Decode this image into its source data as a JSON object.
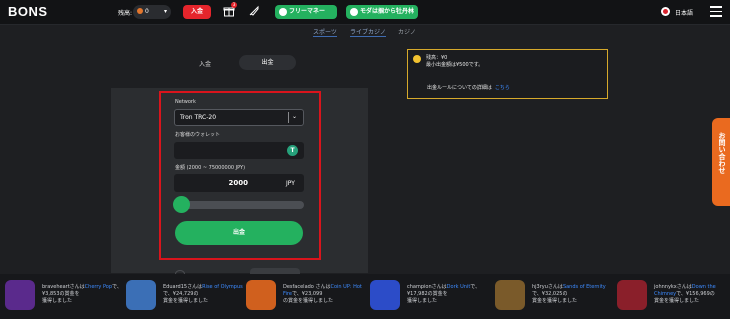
{
  "header": {
    "logo": "BONS",
    "balance_label": "残高:",
    "balance_value": "0",
    "deposit_button": "入金",
    "gift_badge": "3",
    "free_money_button": "フリーマネー",
    "cashout_button": "モダは掴から牡丹林",
    "language": "日本語"
  },
  "nav": {
    "tabs": [
      {
        "label": "スポーツ",
        "active": true
      },
      {
        "label": "ライブカジノ",
        "active": true
      },
      {
        "label": "カジノ",
        "active": false
      }
    ]
  },
  "toggle": {
    "deposit": "入金",
    "withdraw": "出金"
  },
  "notice": {
    "line1": "残高：¥0",
    "line2": "最小出金額は¥500です。",
    "rule_text": "出金ルールについての詳細は",
    "rule_link": "こちら"
  },
  "form": {
    "network_label": "Network",
    "network_value": "Tron TRC-20",
    "wallet_label": "お客様のウォレット",
    "wallet_value": "",
    "amount_label": "金額 (2000 ~ 75000000 JPY)",
    "amount_value": "2000",
    "amount_currency": "JPY",
    "slider_fraction": 0.0,
    "submit_button": "出金"
  },
  "side_tab": "お問い合わせ",
  "winners": [
    {
      "user": "braveheartさんは",
      "game": "Cherry Pop",
      "line2": "で、¥3,853の賞金を",
      "line3": "獲得しました",
      "thumb_color": "#5a2a8c"
    },
    {
      "user": "Eduard15さんは",
      "game": "Rise of Olympus",
      "line2": "で、¥24,729の",
      "line3": "賞金を獲得しました",
      "thumb_color": "#3b6fb6"
    },
    {
      "user": "Desfacelado さんは",
      "game": "Coin UP: Hot Fire",
      "line2": "で、¥23,099",
      "line3": "の賞金を獲得しました",
      "thumb_color": "#d0601e"
    },
    {
      "user": "championさんは",
      "game": "Dork Unit",
      "line2": "で、¥17,982の賞金を",
      "line3": "獲得しました",
      "thumb_color": "#2c4cc8"
    },
    {
      "user": "hj3ryuさんは",
      "game": "Sands of Eternity",
      "line2": "で、¥32,025の",
      "line3": "賞金を獲得しました",
      "thumb_color": "#7a5a2a"
    },
    {
      "user": "johnnykxさんは",
      "game": "Down the Chimney",
      "line2": "で、¥156,969の",
      "line3": "賞金を獲得しました",
      "thumb_color": "#8a1f2a"
    }
  ],
  "colors": {
    "accent_green": "#24b15f",
    "accent_red": "#e5252c",
    "highlight_outline": "#d9141c",
    "notice_border": "#d6a92b",
    "side_tab": "#ea6a1f"
  }
}
